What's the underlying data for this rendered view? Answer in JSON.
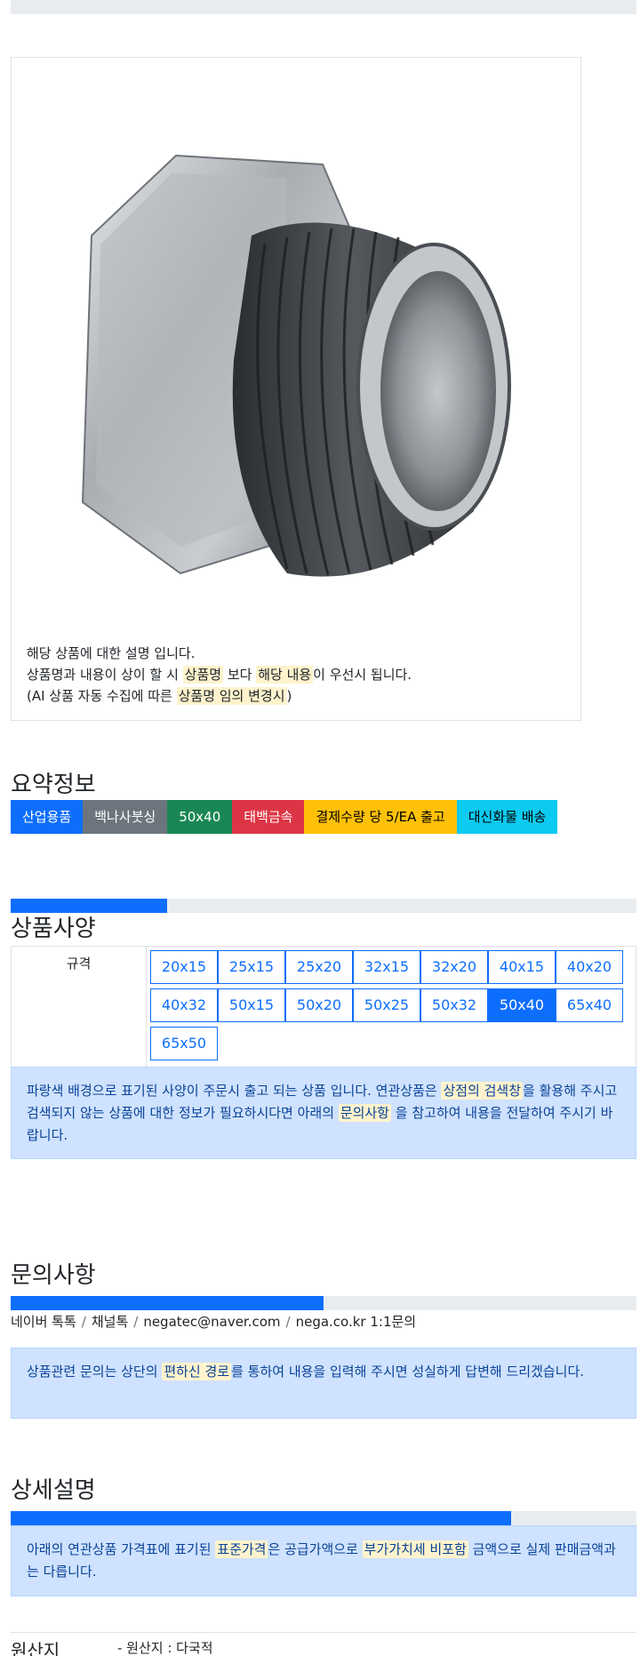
{
  "product": {
    "description_lines": [
      "해당 상품에 대한 설명 입니다."
    ],
    "desc2": {
      "a": "상품명과 내용이 상이 할 시 ",
      "h1": "상품명",
      "b": " 보다 ",
      "h2": "해당 내용",
      "c": "이 우선시 됩니다."
    },
    "desc3": {
      "a": "(AI 상품 자동 수집에 따른 ",
      "h1": "상품명 임의 변경시",
      "c": ")"
    }
  },
  "summary": {
    "title": "요약정보",
    "badges": [
      {
        "label": "산업용품",
        "bg": "#0d6efd",
        "fg": "#ffffff"
      },
      {
        "label": "백나사붓싱",
        "bg": "#6c757d",
        "fg": "#ffffff"
      },
      {
        "label": "50x40",
        "bg": "#198754",
        "fg": "#ffffff"
      },
      {
        "label": "태백금속",
        "bg": "#dc3545",
        "fg": "#ffffff"
      },
      {
        "label": "결제수량 당 5/EA 출고",
        "bg": "#ffc107",
        "fg": "#000000"
      },
      {
        "label": "대신화물 배송",
        "bg": "#0dcaf0",
        "fg": "#000000"
      }
    ]
  },
  "spec": {
    "title": "상품사양",
    "progress_percent": 25,
    "label": "규격",
    "options": [
      "20x15",
      "25x15",
      "25x20",
      "32x15",
      "32x20",
      "40x15",
      "40x20",
      "40x32",
      "50x15",
      "50x20",
      "50x25",
      "50x32",
      "50x40",
      "65x40",
      "65x50"
    ],
    "selected": "50x40",
    "notice": {
      "a": "파랑색 배경으로 표기된 사양이 주문시 출고 되는 상품 입니다. 연관상품은 ",
      "h1": "상점의 검색창",
      "b": "을 활용해 주시고 검색되지 않는 상품에 대한 정보가 필요하시다면 아래의 ",
      "h2": "문의사항",
      "c": " 을 참고하여 내용을 전달하여 주시기 바랍니다."
    }
  },
  "inquiry": {
    "title": "문의사항",
    "progress_percent": 50,
    "channels": [
      "네이버 톡톡",
      "채널톡",
      "negatec@naver.com",
      "nega.co.kr 1:1문의"
    ],
    "separator": "/",
    "notice": {
      "a": "상품관련 문의는 상단의 ",
      "h1": "편하신 경로",
      "b": "를 통하여 내용을 입력해 주시면 성실하게 답변해 드리겠습니다."
    }
  },
  "detail": {
    "title": "상세설명",
    "progress_percent": 80,
    "notice": {
      "a": "아래의 연관상품 가격표에 표기된 ",
      "h1": "표준가격",
      "b": "은 공급가액으로 ",
      "h2": "부가가치세 비포함",
      "c": " 금액으로 실제 판매금액과는 다릅니다."
    }
  },
  "origin": {
    "label": "원산지",
    "value": "- 원산지 : 다국적"
  }
}
